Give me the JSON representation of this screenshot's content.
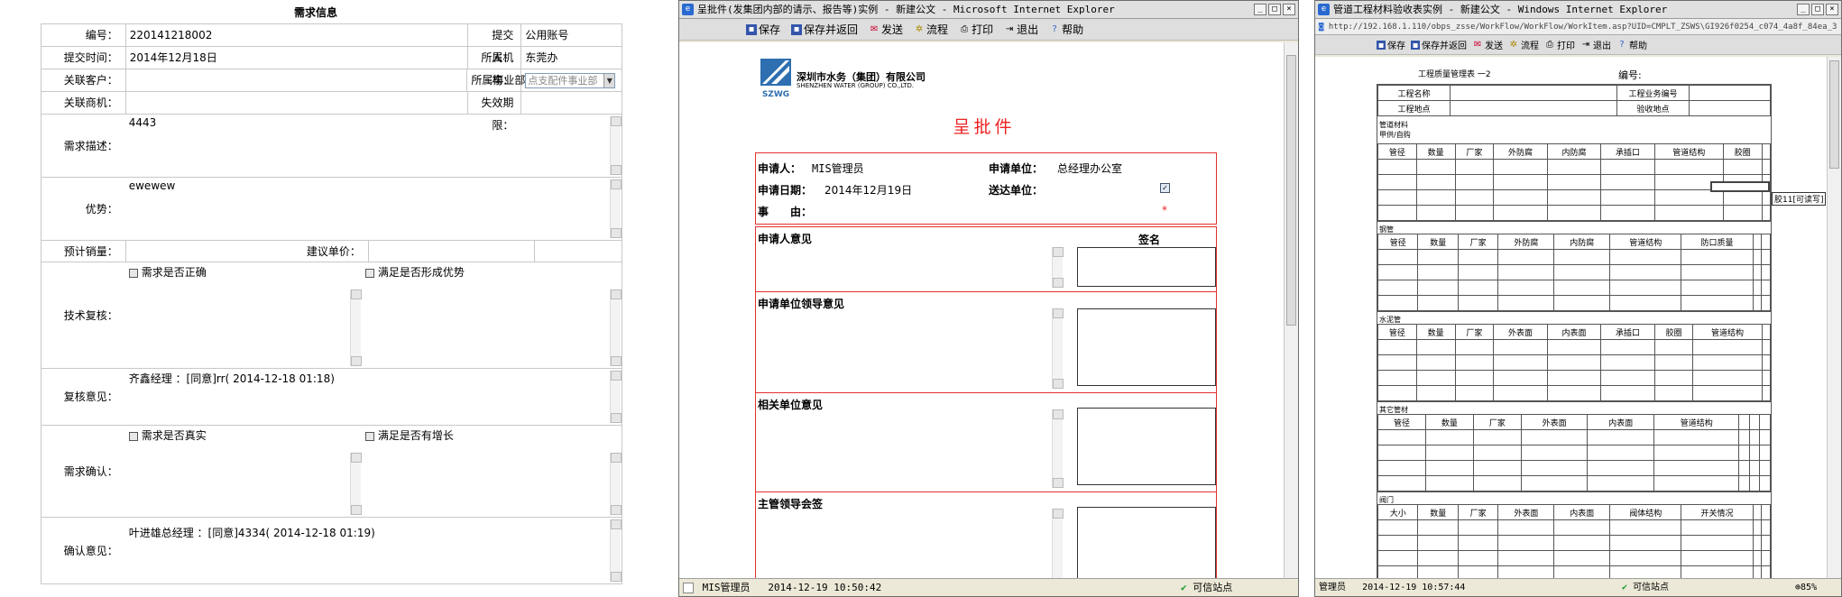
{
  "left_form": {
    "title": "需求信息",
    "rows": {
      "number_label": "编号：",
      "number_value": "220141218002",
      "submitter_label": "提交人：",
      "submitter_value": "公用账号",
      "submit_time_label": "提交时间：",
      "submit_time_value": "2014年12月18日",
      "org_label": "所属机构：",
      "org_value": "东莞办",
      "customer_label": "关联客户：",
      "division_label": "所属事业部：",
      "division_select": "点支配件事业部",
      "opportunity_label": "关联商机：",
      "expiry_label": "失效期限：",
      "desc_label": "需求描述：",
      "desc_value": "4443",
      "advantage_label": "优势：",
      "advantage_value": "ewewew",
      "forecast_label": "预计销量：",
      "unit_price_label": "建议单价：",
      "tech_review_label": "技术复核：",
      "check_correct": "需求是否正确",
      "check_advantage": "满足是否形成优势",
      "review_opinion_label": "复核意见：",
      "review_opinion_value": "齐鑫经理 ：[同意]rr( 2014-12-18 01:18)",
      "confirm_label": "需求确认：",
      "check_real": "需求是否真实",
      "check_growth": "满足是否有增长",
      "confirm_opinion_label": "确认意见：",
      "confirm_opinion_value": "叶进雄总经理 ：[同意]4334( 2014-12-18 01:19)"
    }
  },
  "mid_window": {
    "title": "呈批件(发集团内部的请示、报告等)实例 - 新建公文 - Microsoft Internet Explorer",
    "toolbar": [
      "保存",
      "保存并返回",
      "发送",
      "流程",
      "打印",
      "退出",
      "帮助"
    ],
    "logo_cn": "深圳市水务（集团）有限公司",
    "logo_en": "SHENZHEN WATER (GROUP) CO.,LTD.",
    "logo_abbr": "SZWG",
    "doc_title": "呈批件",
    "applicant_label": "申请人：",
    "applicant_value": "MIS管理员",
    "apply_unit_label": "申请单位：",
    "apply_unit_value": "总经理办公室",
    "apply_date_label": "申请日期：",
    "apply_date_value": "2014年12月19日",
    "send_unit_label": "送达单位：",
    "subject_label": "事　　由：",
    "required_mark": "*",
    "sign_header": "签名",
    "sections": [
      "申请人意见",
      "申请单位领导意见",
      "相关单位意见",
      "主管领导会签"
    ],
    "status_user": "MIS管理员",
    "status_time": "2014-12-19 10:50:42",
    "status_zone": "可信站点"
  },
  "right_window": {
    "title": "管道工程材料验收表实例 - 新建公文 - Windows Internet Explorer",
    "url": "http://192.168.1.110/obps_zsse/WorkFlow/WorkFlow/WorkItem.asp?UID=CMPLT_ZSWS\\GI926f0254_c074_4a8f_84ea_3",
    "toolbar": [
      "保存",
      "保存并返回",
      "发送",
      "流程",
      "打印",
      "退出",
      "帮助"
    ],
    "form_title": "工程质量管理表 一2",
    "form_number": "编号:",
    "proj_name": "工程名称",
    "proj_code": "工程业务编号",
    "proj_site": "工程地点",
    "accept_site": "验收地点",
    "pipe_label": "管道材料",
    "supply_label": "甲供/自购",
    "sections": [
      {
        "name": "",
        "cols": [
          "管径",
          "数量",
          "厂家",
          "外防腐",
          "内防腐",
          "承插口",
          "管道结构",
          "胶圈"
        ]
      },
      {
        "name": "钢管",
        "cols": [
          "管径",
          "数量",
          "厂家",
          "外防腐",
          "内防腐",
          "管道结构",
          "防口质量"
        ]
      },
      {
        "name": "水泥管",
        "cols": [
          "管径",
          "数量",
          "厂家",
          "外表面",
          "内表面",
          "承插口",
          "胶圈",
          "管道结构"
        ]
      },
      {
        "name": "其它管材",
        "cols": [
          "管径",
          "数量",
          "厂家",
          "外表面",
          "内表面",
          "管道结构"
        ]
      },
      {
        "name": "阀门",
        "cols": [
          "大小",
          "数量",
          "厂家",
          "外表面",
          "内表面",
          "阀体结构",
          "开关情况"
        ]
      }
    ],
    "tooltip": "胶11[可读写]",
    "status_user": "管理员",
    "status_time": "2014-12-19 10:57:44",
    "status_zone": "可信站点",
    "zoom": "85%"
  }
}
